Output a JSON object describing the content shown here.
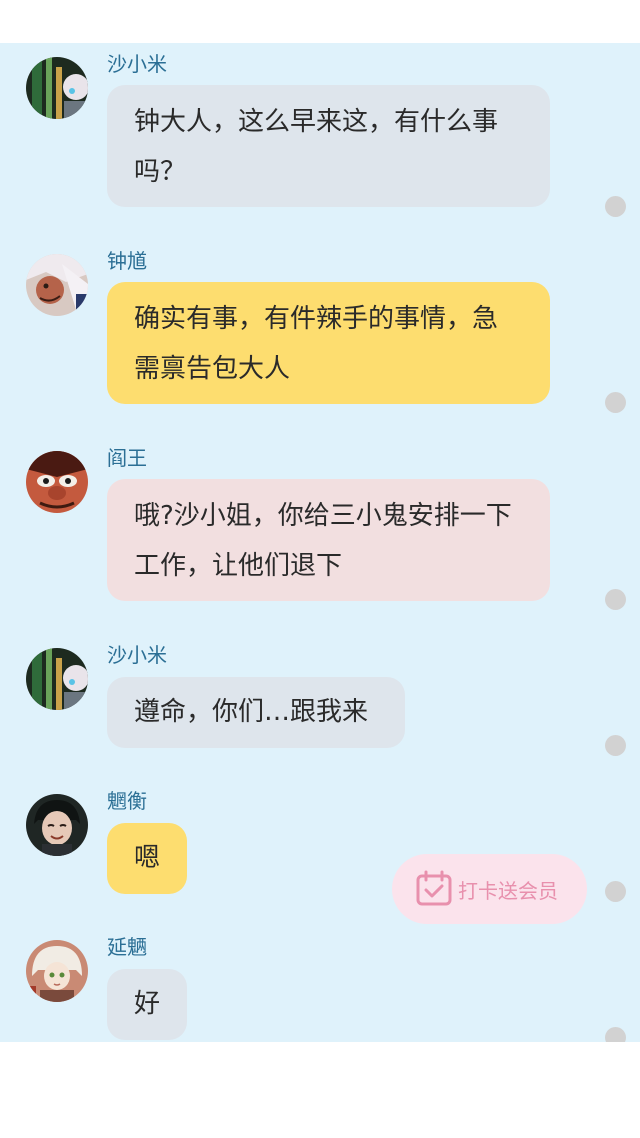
{
  "messages": [
    {
      "sender": "沙小米",
      "text": "钟大人，这么早来这，有什么事吗？",
      "bubble_color": "#dee5ec",
      "avatar": "sha-xiaomi-avatar"
    },
    {
      "sender": "钟馗",
      "text": "确实有事，有件辣手的事情，急需禀告包大人",
      "bubble_color": "#fddd6f",
      "avatar": "zhong-kui-avatar"
    },
    {
      "sender": "阎王",
      "text": "哦?沙小姐，你给三小鬼安排一下工作，让他们退下",
      "bubble_color": "#f2dfe0",
      "avatar": "yan-wang-avatar"
    },
    {
      "sender": "沙小米",
      "text": "遵命，你们…跟我来",
      "bubble_color": "#dee5ec",
      "avatar": "sha-xiaomi-avatar"
    },
    {
      "sender": "魍衡",
      "text": "嗯",
      "bubble_color": "#fddd6f",
      "avatar": "wang-heng-avatar"
    },
    {
      "sender": "延魉",
      "text": "好",
      "bubble_color": "#dee5ec",
      "avatar": "yan-liang-avatar"
    }
  ],
  "promo": {
    "label": "打卡送会员",
    "icon": "calendar-check-icon",
    "color": "#e890ad"
  },
  "colors": {
    "chat_background": "#dff2fb",
    "sender_name": "#2b6f95"
  }
}
